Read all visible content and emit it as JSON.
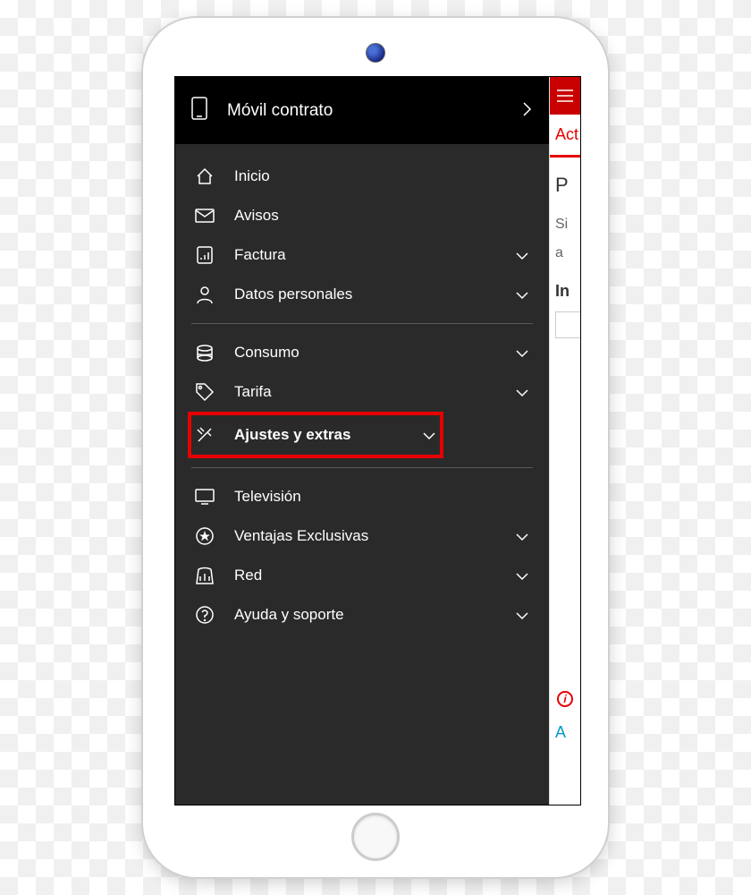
{
  "sidebar": {
    "header": {
      "title": "Móvil contrato"
    },
    "group1": [
      {
        "icon": "home-icon",
        "label": "Inicio",
        "chevron": false
      },
      {
        "icon": "mail-icon",
        "label": "Avisos",
        "chevron": false
      },
      {
        "icon": "invoice-icon",
        "label": "Factura",
        "chevron": true
      },
      {
        "icon": "user-icon",
        "label": "Datos personales",
        "chevron": true
      }
    ],
    "group2": [
      {
        "icon": "consumption-icon",
        "label": "Consumo",
        "chevron": true
      },
      {
        "icon": "tag-icon",
        "label": "Tarifa",
        "chevron": true
      },
      {
        "icon": "tools-icon",
        "label": "Ajustes y extras",
        "chevron": true,
        "highlighted": true
      }
    ],
    "group3": [
      {
        "icon": "tv-icon",
        "label": "Televisión",
        "chevron": false
      },
      {
        "icon": "star-icon",
        "label": "Ventajas Exclusivas",
        "chevron": true
      },
      {
        "icon": "network-icon",
        "label": "Red",
        "chevron": true
      },
      {
        "icon": "help-icon",
        "label": "Ayuda y soporte",
        "chevron": true
      }
    ]
  },
  "right": {
    "tab": "Act",
    "heading": "P",
    "line1": "Si",
    "line2": "a",
    "bold": "In",
    "info": "i",
    "link": "A"
  }
}
